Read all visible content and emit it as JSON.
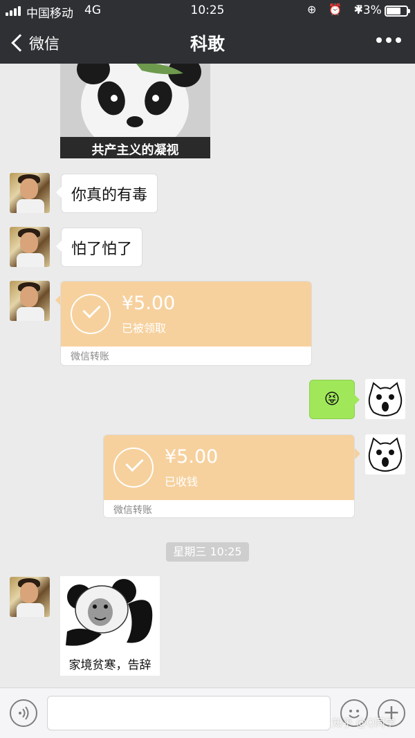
{
  "status_bar": {
    "carrier": "中国移动",
    "network": "4G",
    "time": "10:25",
    "icons": "⊕ ⏰ ✱",
    "battery": "73%",
    "battery_level": 0.73
  },
  "nav": {
    "back_label": "微信",
    "title": "科敢",
    "more_icon": "more-dots-icon"
  },
  "messages": {
    "sticker_panda_caption": "共产主义的凝视",
    "text1": "你真的有毒",
    "text2": "怕了怕了",
    "transfer1": {
      "amount": "¥5.00",
      "status": "已被领取",
      "label": "微信转账"
    },
    "emoji_reply": "😝",
    "transfer2": {
      "amount": "¥5.00",
      "status": "已收钱",
      "label": "微信转账"
    },
    "timestamp": "星期三 10:25",
    "sticker_meme_caption": "家境贫寒，告辞"
  },
  "input_bar": {
    "voice_icon": "voice-icon",
    "emoji_icon": "emoji-icon",
    "plus_icon": "plus-icon"
  },
  "watermark": "知乎 @Q同学",
  "colors": {
    "nav_bg": "#2e3034",
    "chat_bg": "#ebebeb",
    "transfer_orange": "#f6d19e",
    "sent_green": "#a0e75a"
  }
}
